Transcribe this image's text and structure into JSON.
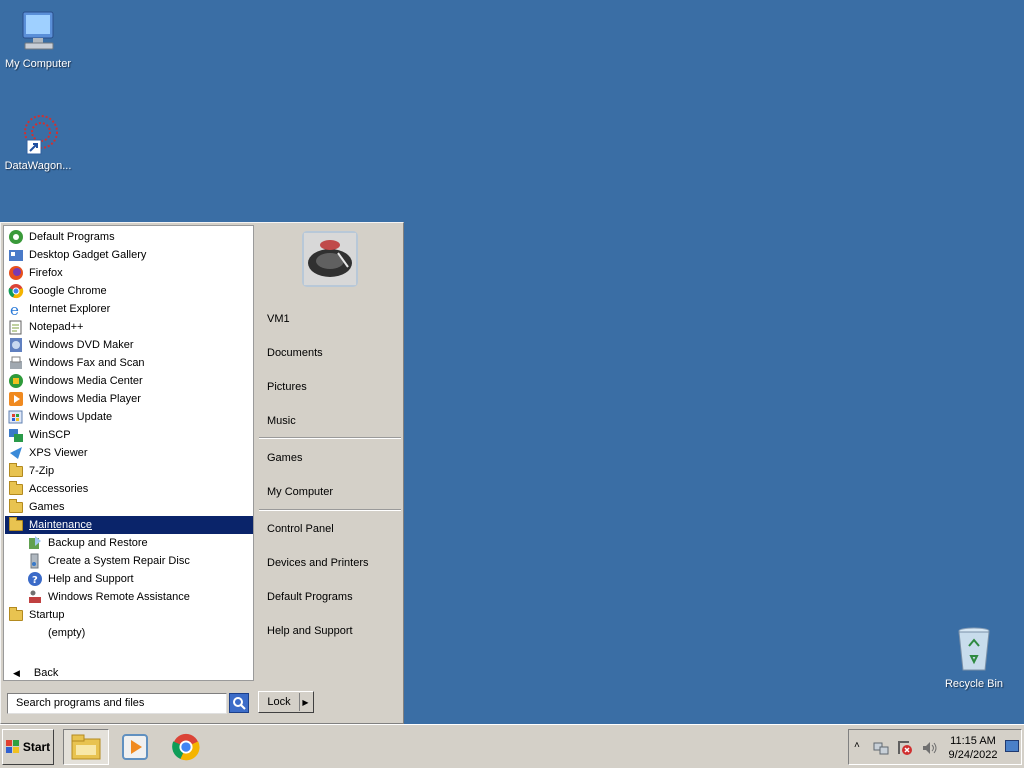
{
  "desktop": {
    "icons": [
      {
        "label": "My Computer"
      },
      {
        "label": "DataWagon..."
      },
      {
        "label": "Recycle Bin"
      }
    ]
  },
  "start_menu": {
    "programs": [
      {
        "label": "Default Programs",
        "icon": "default-programs-icon"
      },
      {
        "label": "Desktop Gadget Gallery",
        "icon": "gadget-icon"
      },
      {
        "label": "Firefox",
        "icon": "firefox-icon"
      },
      {
        "label": "Google Chrome",
        "icon": "chrome-icon"
      },
      {
        "label": "Internet Explorer",
        "icon": "ie-icon"
      },
      {
        "label": "Notepad++",
        "icon": "notepad-icon"
      },
      {
        "label": "Windows DVD Maker",
        "icon": "dvd-maker-icon"
      },
      {
        "label": "Windows Fax and Scan",
        "icon": "fax-icon"
      },
      {
        "label": "Windows Media Center",
        "icon": "media-center-icon"
      },
      {
        "label": "Windows Media Player",
        "icon": "media-player-icon"
      },
      {
        "label": "Windows Update",
        "icon": "windows-update-icon"
      },
      {
        "label": "WinSCP",
        "icon": "winscp-icon"
      },
      {
        "label": "XPS Viewer",
        "icon": "xps-icon"
      },
      {
        "label": "7-Zip",
        "icon": "folder-icon"
      },
      {
        "label": "Accessories",
        "icon": "folder-icon"
      },
      {
        "label": "Games",
        "icon": "folder-icon"
      },
      {
        "label": "Maintenance",
        "icon": "folder-icon"
      },
      {
        "label": "Backup and Restore",
        "icon": "backup-icon"
      },
      {
        "label": "Create a System Repair Disc",
        "icon": "repair-disc-icon"
      },
      {
        "label": "Help and Support",
        "icon": "help-icon"
      },
      {
        "label": "Windows Remote Assistance",
        "icon": "remote-assistance-icon"
      },
      {
        "label": "Startup",
        "icon": "folder-icon"
      },
      {
        "label": "(empty)",
        "icon": ""
      }
    ],
    "back_label": "Back",
    "search_placeholder": "Search programs and files",
    "right_items": {
      "user": "VM1",
      "documents": "Documents",
      "pictures": "Pictures",
      "music": "Music",
      "games": "Games",
      "my_computer": "My Computer",
      "control_panel": "Control Panel",
      "devices_printers": "Devices and Printers",
      "default_programs": "Default Programs",
      "help_support": "Help and Support"
    },
    "lock_label": "Lock"
  },
  "taskbar": {
    "start_label": "Start",
    "time": "11:15 AM",
    "date": "9/24/2022"
  },
  "colors": {
    "desktop": "#3a6ea5",
    "selection": "#0a246a",
    "chrome_face": "#d4d0c8"
  }
}
